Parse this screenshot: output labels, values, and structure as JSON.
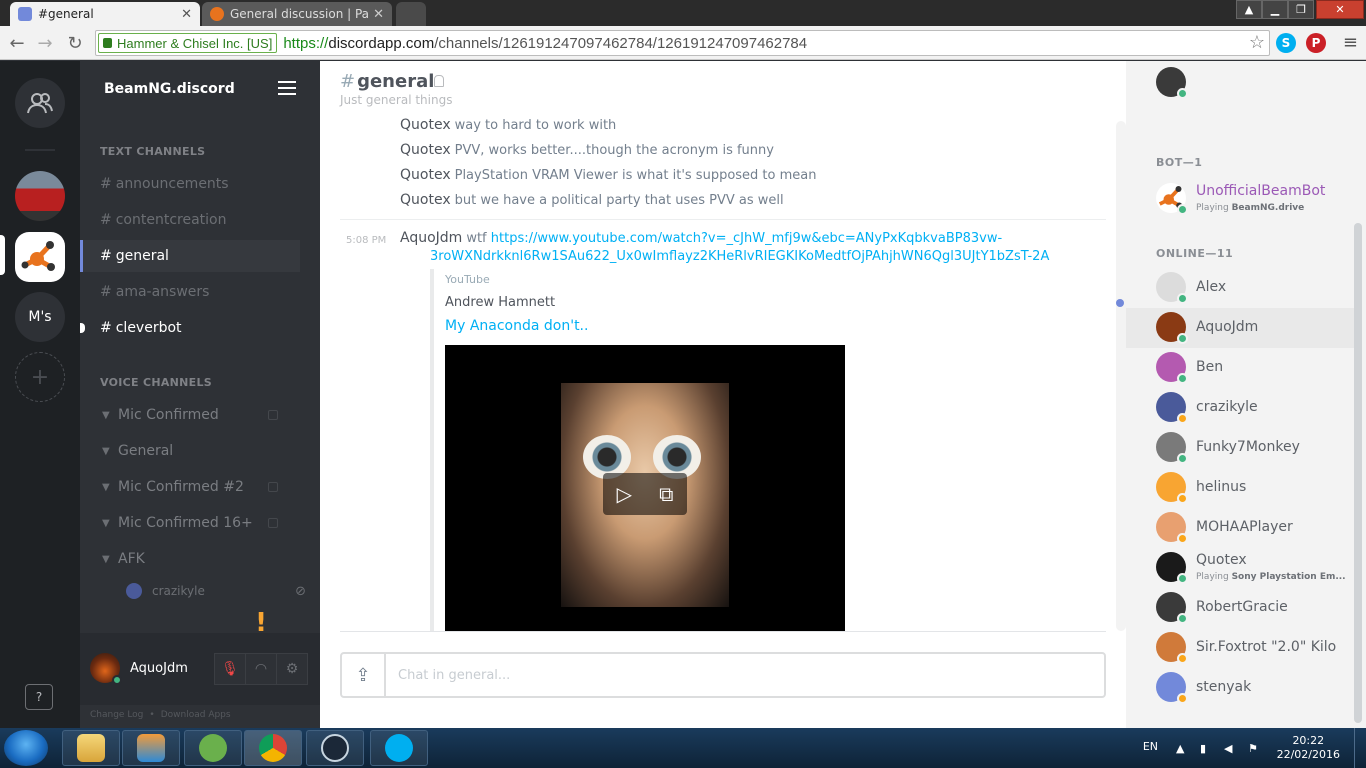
{
  "browser": {
    "tabs": [
      {
        "title": "#general",
        "active": true
      },
      {
        "title": "General discussion | Page",
        "active": false
      }
    ],
    "ev_cert": "Hammer & Chisel Inc. [US]",
    "url_scheme": "https://",
    "url_host": "discordapp.com",
    "url_path": "/channels/126191247097462784/126191247097462784"
  },
  "guilds": {
    "ms_label": "M's",
    "add_label": "+",
    "help_label": "?"
  },
  "server": {
    "name": "BeamNG.discord",
    "text_category": "TEXT CHANNELS",
    "text_channels": [
      {
        "name": "announcements"
      },
      {
        "name": "contentcreation"
      },
      {
        "name": "general"
      },
      {
        "name": "ama-answers"
      },
      {
        "name": "cleverbot"
      }
    ],
    "voice_category": "VOICE CHANNELS",
    "voice_channels": [
      {
        "name": "Mic Confirmed"
      },
      {
        "name": "General"
      },
      {
        "name": "Mic Confirmed #2"
      },
      {
        "name": "Mic Confirmed 16+"
      },
      {
        "name": "AFK"
      }
    ],
    "voice_user": "crazikyle",
    "notice_glyph": "!",
    "footer": {
      "changelog": "Change Log",
      "sep": "•",
      "download": "Download Apps"
    }
  },
  "current_user": {
    "name": "AquoJdm"
  },
  "chat": {
    "channel_name": "general",
    "channel_hash": "#",
    "topic": "Just general things",
    "prev_messages": [
      {
        "author": "Quotex",
        "text": "way to hard to work with"
      },
      {
        "author": "Quotex",
        "text": "PVV, works better....though the acronym is funny"
      },
      {
        "author": "Quotex",
        "text": "PlayStation VRAM Viewer is what it's supposed to mean"
      },
      {
        "author": "Quotex",
        "text": "but we have a political party that uses PVV as well"
      }
    ],
    "message": {
      "timestamp": "5:08 PM",
      "author": "AquoJdm",
      "text": "wtf",
      "link_line1": "https://www.youtube.com/watch?v=_cJhW_mfj9w&ebc=ANyPxKqbkvaBP83vw-",
      "link_line2": "3roWXNdrkknl6Rw1SAu622_Ux0wImflayz2KHeRlvRIEGKIKoMedtfOjPAhjhWN6Qgl3UJtY1bZsT-2A"
    },
    "embed": {
      "provider": "YouTube",
      "author": "Andrew Hamnett",
      "title": "My Anaconda don't.."
    },
    "input_placeholder": "Chat in general..."
  },
  "members": {
    "bot_header": "BOT—1",
    "bot": {
      "name": "UnofficialBeamBot",
      "playing_prefix": "Playing ",
      "game": "BeamNG.drive"
    },
    "online_header": "ONLINE—11",
    "online": [
      {
        "name": "Alex",
        "status": "online",
        "color": "#dcdcdc"
      },
      {
        "name": "AquoJdm",
        "status": "online",
        "color": "#8a3a14"
      },
      {
        "name": "Ben",
        "status": "online",
        "color": "#b45ab0"
      },
      {
        "name": "crazikyle",
        "status": "idle",
        "color": "#4a5a9a"
      },
      {
        "name": "Funky7Monkey",
        "status": "online",
        "color": "#7a7a7a"
      },
      {
        "name": "helinus",
        "status": "idle",
        "color": "#f8a532"
      },
      {
        "name": "MOHAAPlayer",
        "status": "idle",
        "color": "#e8a070"
      },
      {
        "name": "Quotex",
        "status": "online",
        "color": "#1a1a1a",
        "playing_prefix": "Playing ",
        "game": "Sony Playstation Em..."
      },
      {
        "name": "RobertGracie",
        "status": "online",
        "color": "#3a3a3a"
      },
      {
        "name": "Sir.Foxtrot \"2.0\" Kilo",
        "status": "idle",
        "color": "#d07a3a"
      },
      {
        "name": "stenyak",
        "status": "idle",
        "color": "#7289da"
      }
    ],
    "status_colors": {
      "online": "#43b581",
      "idle": "#faa61a"
    }
  },
  "taskbar": {
    "lang": "EN",
    "time": "20:22",
    "date": "22/02/2016"
  }
}
